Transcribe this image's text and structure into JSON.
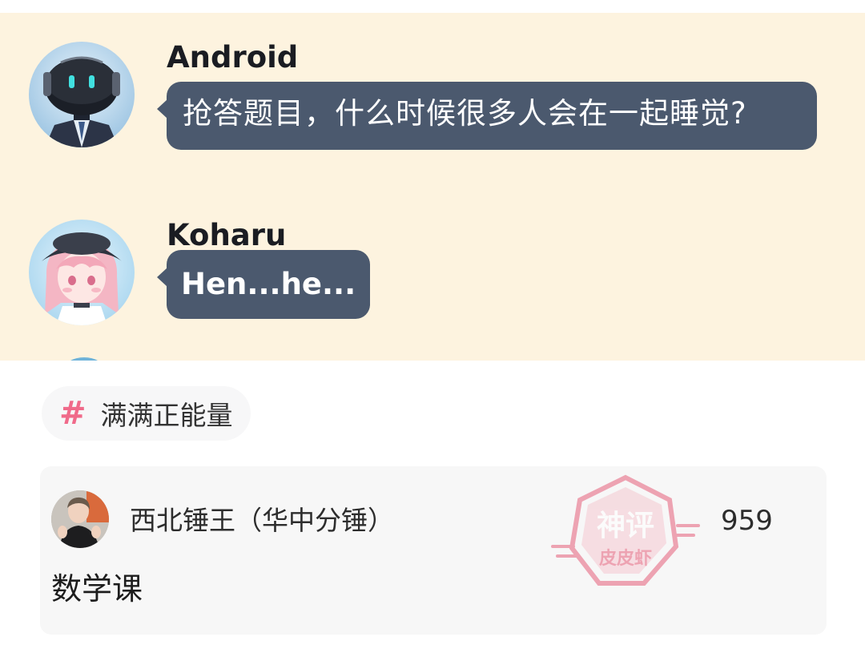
{
  "chat": {
    "messages": [
      {
        "sender": "Android",
        "text": "抢答题目，什么时候很多人会在一起睡觉?",
        "avatar_icon": "android-robot-avatar-icon"
      },
      {
        "sender": "Koharu",
        "text": "Hen...he...",
        "avatar_icon": "koharu-anime-girl-avatar-icon"
      }
    ],
    "colors": {
      "background": "#fdf3df",
      "bubble": "#4b596e",
      "bubble_text": "#ffffff"
    }
  },
  "topic": {
    "label": "满满正能量",
    "icon": "hashtag-icon",
    "icon_color": "#f06a8a"
  },
  "comment": {
    "user_name": "西北锤王（华中分锤）",
    "like_count": "959",
    "text": "数学课",
    "avatar_icon": "user-avatar-icon",
    "stamp": {
      "line1": "神评",
      "line2": "皮皮虾",
      "color": "#e65f7a"
    }
  }
}
